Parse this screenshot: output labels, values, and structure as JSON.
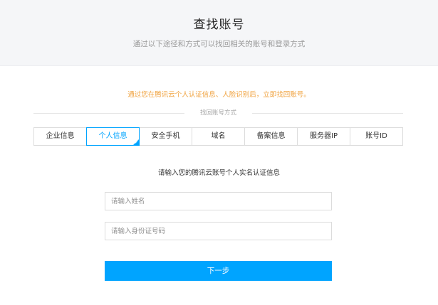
{
  "header": {
    "title": "查找账号",
    "subtitle": "通过以下途径和方式可以找回相关的账号和登录方式"
  },
  "notice": "通过您在腾讯云个人认证信息、人脸识别后，立即找回账号。",
  "divider_label": "找回账号方式",
  "tabs": [
    {
      "label": "企业信息",
      "active": false
    },
    {
      "label": "个人信息",
      "active": true
    },
    {
      "label": "安全手机",
      "active": false
    },
    {
      "label": "域名",
      "active": false
    },
    {
      "label": "备案信息",
      "active": false
    },
    {
      "label": "服务器IP",
      "active": false
    },
    {
      "label": "账号ID",
      "active": false
    }
  ],
  "prompt": "请输入您的腾讯云账号个人实名认证信息",
  "form": {
    "name_placeholder": "请输入姓名",
    "name_value": "",
    "idcard_placeholder": "请输入身份证号码",
    "idcard_value": ""
  },
  "next_button": "下一步",
  "colors": {
    "accent": "#00a4ff",
    "notice": "#f0a23e",
    "header_bg": "#f5f6f8"
  }
}
